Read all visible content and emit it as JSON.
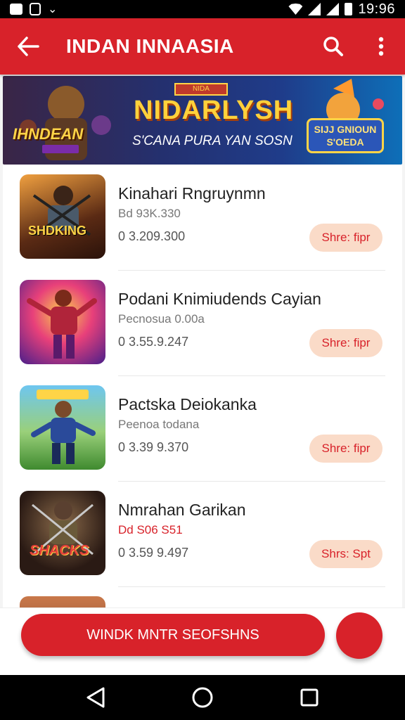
{
  "status_bar": {
    "time": "19:96"
  },
  "app_bar": {
    "title": "INDAN INNAASIA"
  },
  "banner": {
    "left_text": "IHNDEAN",
    "tag": "NIDA",
    "title": "NIDARLYSH",
    "subtitle": "S'CANA PURA YAN SOSN",
    "badge": "SIJJ GNIOUN S'OEDA"
  },
  "games": [
    {
      "name": "Kinahari Rngruynmn",
      "meta": "Bd 93K.330",
      "price": "0 3.209.300",
      "share_label": "Shre: fipr",
      "thumb_text": "SHDKING"
    },
    {
      "name": "Podani Knimiudends Cayian",
      "meta": "Pecnosua 0.00a",
      "price": "0 3.55.9.247",
      "share_label": "Shre: fipr",
      "thumb_text": ""
    },
    {
      "name": "Pactska Deiokanka",
      "meta": "Peenoa todana",
      "price": "0 3.39 9.370",
      "share_label": "Shre: fipr",
      "thumb_text": ""
    },
    {
      "name": "Nmrahan Garikan",
      "meta": "Dd S06 S51",
      "price": "0 3.59 9.497",
      "share_label": "Shrs: Spt",
      "thumb_text": "SHACKS"
    }
  ],
  "bottom": {
    "cta_label": "WINDK MNTR SEOFSHNS"
  },
  "colors": {
    "primary": "#d8222a",
    "share_bg": "#fadbc8"
  }
}
